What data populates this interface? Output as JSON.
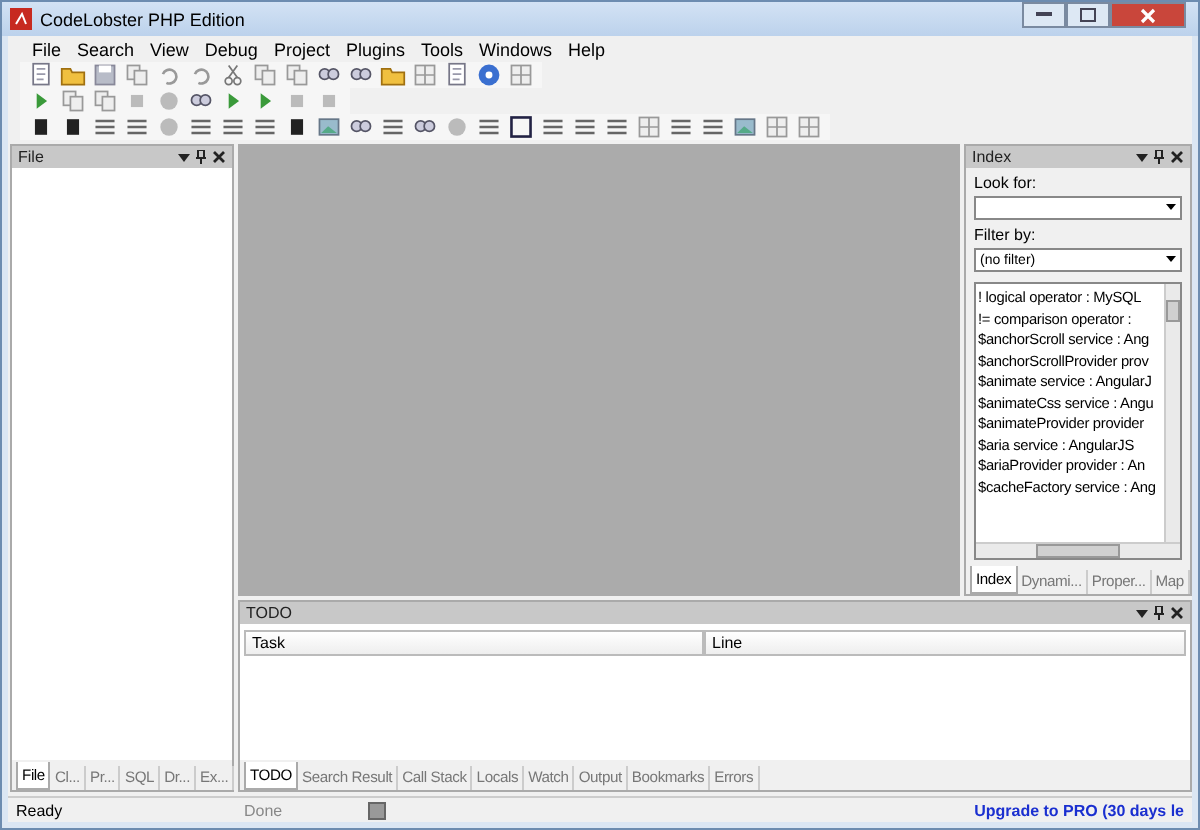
{
  "window": {
    "title": "CodeLobster PHP Edition"
  },
  "menu": [
    {
      "label": "File"
    },
    {
      "label": "Search"
    },
    {
      "label": "View"
    },
    {
      "label": "Debug"
    },
    {
      "label": "Project"
    },
    {
      "label": "Plugins"
    },
    {
      "label": "Tools"
    },
    {
      "label": "Windows"
    },
    {
      "label": "Help"
    }
  ],
  "file_panel": {
    "title": "File",
    "tabs": [
      {
        "label": "File",
        "selected": true
      },
      {
        "label": "Cl...",
        "selected": false
      },
      {
        "label": "Pr...",
        "selected": false
      },
      {
        "label": "SQL",
        "selected": false
      },
      {
        "label": "Dr...",
        "selected": false
      },
      {
        "label": "Ex...",
        "selected": false
      }
    ]
  },
  "index_panel": {
    "title": "Index",
    "look_for_label": "Look for:",
    "filter_label": "Filter by:",
    "filter_value": "(no filter)",
    "items": [
      "! logical operator : MySQL",
      "!= comparison operator :",
      "$anchorScroll service : Ang",
      "$anchorScrollProvider prov",
      "$animate service : AngularJ",
      "$animateCss service : Angu",
      "$animateProvider provider",
      "$aria service : AngularJS",
      "$ariaProvider provider : An",
      "$cacheFactory service : Ang"
    ],
    "tabs": [
      {
        "label": "Index",
        "selected": true
      },
      {
        "label": "Dynami...",
        "selected": false
      },
      {
        "label": "Proper...",
        "selected": false
      },
      {
        "label": "Map",
        "selected": false
      }
    ]
  },
  "todo_panel": {
    "title": "TODO",
    "columns": [
      "Task",
      "Line"
    ],
    "tabs": [
      {
        "label": "TODO",
        "selected": true
      },
      {
        "label": "Search Result",
        "selected": false
      },
      {
        "label": "Call Stack",
        "selected": false
      },
      {
        "label": "Locals",
        "selected": false
      },
      {
        "label": "Watch",
        "selected": false
      },
      {
        "label": "Output",
        "selected": false
      },
      {
        "label": "Bookmarks",
        "selected": false
      },
      {
        "label": "Errors",
        "selected": false
      }
    ]
  },
  "status_bar": {
    "status": "Ready",
    "progress": "Done",
    "upgrade_link": "Upgrade to PRO (30 days le"
  }
}
